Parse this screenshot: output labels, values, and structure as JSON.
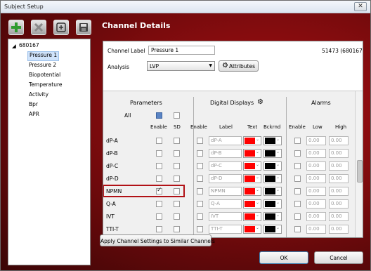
{
  "window": {
    "title": "Subject Setup",
    "close_glyph": "✕"
  },
  "toolbar": {
    "icons": [
      "add-icon",
      "delete-icon",
      "copy-icon",
      "save-icon"
    ]
  },
  "heading": "Channel Details",
  "tree": {
    "root": "680167",
    "expand_glyph": "◢",
    "items": [
      "Pressure 1",
      "Pressure 2",
      "Biopotential",
      "Temperature",
      "Activity",
      "Bpr",
      "APR"
    ],
    "selected": "Pressure 1"
  },
  "channel": {
    "label_caption": "Channel Label",
    "label_value": "Pressure 1",
    "id_text": "51473 (680167)",
    "analysis_caption": "Analysis",
    "analysis_value": "LVP",
    "attributes_button": "Attributes"
  },
  "sections": {
    "parameters": "Parameters",
    "digital_displays": "Digital Displays",
    "alarms": "Alarms"
  },
  "all_label": "All",
  "columns": {
    "param_enable": "Enable",
    "param_sd": "SD",
    "dd_enable": "Enable",
    "dd_label": "Label",
    "dd_text": "Text",
    "dd_bckrnd": "Bckrnd",
    "al_enable": "Enable",
    "al_low": "Low",
    "al_high": "High"
  },
  "colors": {
    "text_color": "#ff0000",
    "bg_color": "#000000",
    "highlight": "#b11116"
  },
  "rows": [
    {
      "name": "dP-A",
      "label": "dP-A",
      "enable": false,
      "low": "0.00",
      "high": "0.00"
    },
    {
      "name": "dP-B",
      "label": "dP-B",
      "enable": false,
      "low": "0.00",
      "high": "0.00"
    },
    {
      "name": "dP-C",
      "label": "dP-C",
      "enable": false,
      "low": "0.00",
      "high": "0.00"
    },
    {
      "name": "dP-D",
      "label": "dP-D",
      "enable": false,
      "low": "0.00",
      "high": "0.00"
    },
    {
      "name": "NPMN",
      "label": "NPMN",
      "enable": true,
      "low": "0.00",
      "high": "0.00"
    },
    {
      "name": "Q-A",
      "label": "Q-A",
      "enable": false,
      "low": "0.00",
      "high": "0.00"
    },
    {
      "name": "IVT",
      "label": "IVT",
      "enable": false,
      "low": "0.00",
      "high": "0.00"
    },
    {
      "name": "TTI-T",
      "label": "TTI-T",
      "enable": false,
      "low": "0.00",
      "high": "0.00"
    }
  ],
  "buttons": {
    "apply": "Apply Channel Settings to Similar Channels",
    "ok": "OK",
    "cancel": "Cancel"
  }
}
